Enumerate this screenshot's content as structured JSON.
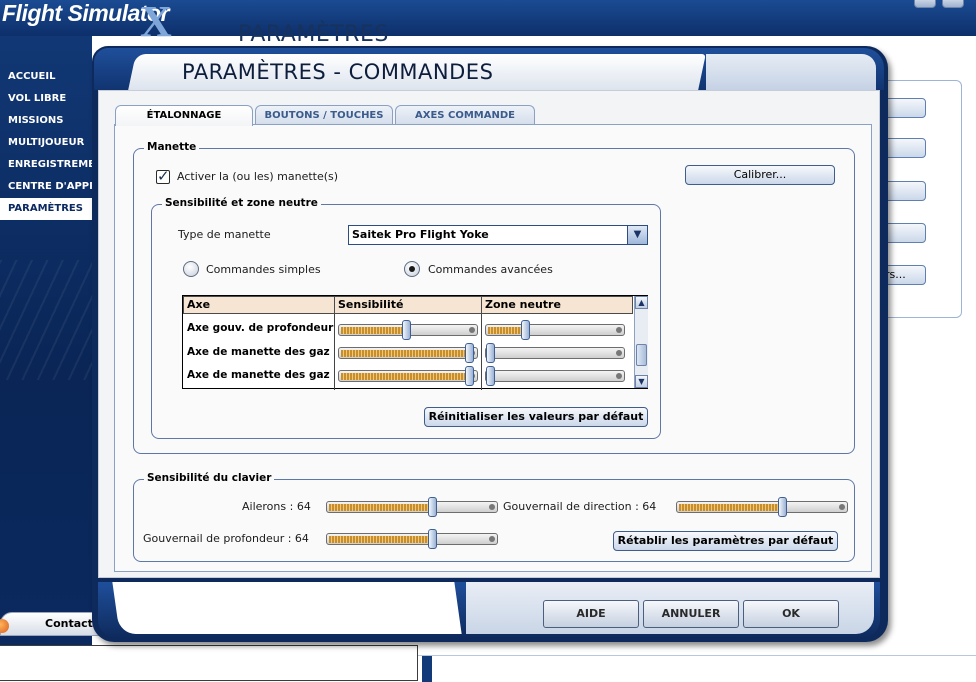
{
  "background": {
    "brand": "Flight Simulator",
    "brand_x": "X",
    "page_title": "PARAMÈTRES",
    "nav": [
      {
        "label": "ACCUEIL"
      },
      {
        "label": "VOL LIBRE"
      },
      {
        "label": "MISSIONS"
      },
      {
        "label": "MULTIJOUEUR"
      },
      {
        "label": "ENREGISTREMENTS"
      },
      {
        "label": "CENTRE D'APPRENTISSAGE"
      },
      {
        "label": "PARAMÈTRES"
      }
    ],
    "right_button_partial": "rs...",
    "contacts": "Contacts"
  },
  "dialog": {
    "title": "PARAMÈTRES - COMMANDES",
    "tabs": [
      {
        "label": "ÉTALONNAGE",
        "active": true
      },
      {
        "label": "BOUTONS / TOUCHES",
        "active": false
      },
      {
        "label": "AXES COMMANDE",
        "active": false
      }
    ],
    "manette": {
      "title": "Manette",
      "enable_label": "Activer la (ou les) manette(s)",
      "enable_checked": true,
      "calibrate_button": "Calibrer..."
    },
    "sensitivity": {
      "title": "Sensibilité et zone neutre",
      "type_label": "Type de manette",
      "type_value": "Saitek Pro Flight Yoke",
      "mode_simple": "Commandes simples",
      "mode_advanced": "Commandes avancées",
      "mode_selected": "advanced",
      "columns": [
        "Axe",
        "Sensibilité",
        "Zone neutre"
      ],
      "rows": [
        {
          "axis": "Axe gouv. de profondeur",
          "sensitivity": 0.5,
          "deadzone": 0.28
        },
        {
          "axis": "Axe de manette des gaz",
          "sensitivity": 1.0,
          "deadzone": 0.0
        },
        {
          "axis": "Axe de manette des gaz",
          "sensitivity": 1.0,
          "deadzone": 0.0
        }
      ],
      "reset_button": "Réinitialiser les valeurs par défaut"
    },
    "keyboard": {
      "title": "Sensibilité du clavier",
      "ailerons_label": "Ailerons : 64",
      "rudder_label": "Gouvernail de direction : 64",
      "elevator_label": "Gouvernail de profondeur : 64",
      "ailerons_value": 0.64,
      "rudder_value": 0.64,
      "elevator_value": 0.64,
      "restore_button": "Rétablir les paramètres par défaut"
    },
    "footer": {
      "help": "AIDE",
      "cancel": "ANNULER",
      "ok": "OK"
    }
  },
  "colors": {
    "frame_blue": "#0e2a5c",
    "header_beige": "#f6e5d2",
    "slider_fill": "#c88e2c"
  }
}
